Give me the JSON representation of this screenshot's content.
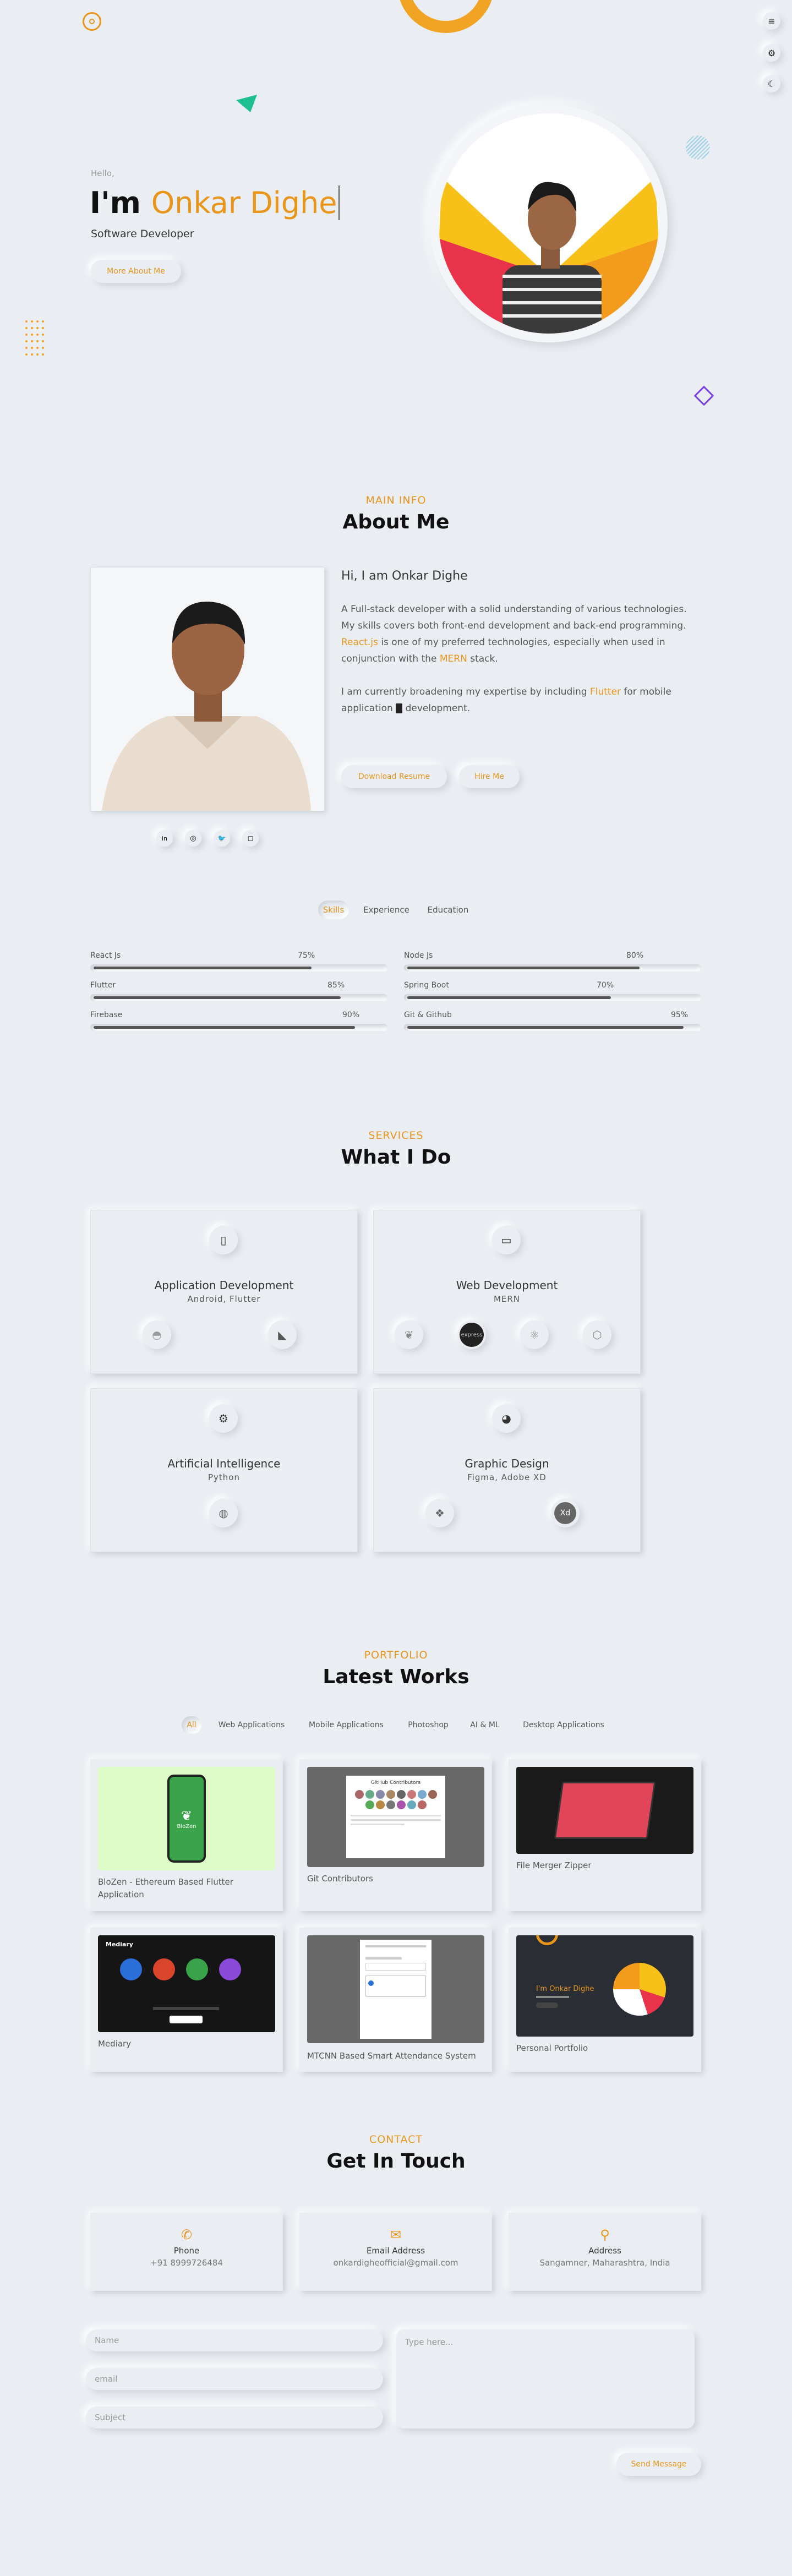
{
  "colors": {
    "accent": "#e8951a",
    "background": "#eaeef3",
    "text": "#111111"
  },
  "hero": {
    "hello": "Hello,",
    "im": "I'm ",
    "name": "Onkar Dighe",
    "role": "Software Developer",
    "more_btn": "More About Me"
  },
  "side_controls": [
    "menu-icon",
    "gear-icon",
    "moon-icon"
  ],
  "about": {
    "subtitle": "MAIN INFO",
    "title": "About Me",
    "greeting": "Hi, I am Onkar Dighe",
    "p1": "A Full-stack developer with a solid understanding of various technologies.",
    "p2": "My skills covers both front-end development and back-end programming.",
    "p3_a": "React.js",
    "p3_b": " is one of my preferred technologies, especially when used in conjunction with the ",
    "p3_c": "MERN",
    "p3_d": " stack.",
    "p4_a": "I am currently broadening my expertise by including ",
    "p4_b": "Flutter",
    "p4_c": " for mobile application ",
    "p4_d": " development.",
    "download_btn": "Download Resume",
    "hire_btn": "Hire Me",
    "socials": [
      "linkedin-icon",
      "github-icon",
      "twitter-icon",
      "instagram-icon"
    ]
  },
  "skill_tabs": [
    "Skills",
    "Experience",
    "Education"
  ],
  "skills": [
    {
      "name": "React Js",
      "value": 75,
      "label": "75%"
    },
    {
      "name": "Node Js",
      "value": 80,
      "label": "80%"
    },
    {
      "name": "Flutter",
      "value": 85,
      "label": "85%"
    },
    {
      "name": "Spring Boot",
      "value": 70,
      "label": "70%"
    },
    {
      "name": "Firebase",
      "value": 90,
      "label": "90%"
    },
    {
      "name": "Git & Github",
      "value": 95,
      "label": "95%"
    }
  ],
  "services": {
    "subtitle": "SERVICES",
    "title": "What I Do",
    "items": [
      {
        "title": "Application Development",
        "sub": "Android, Flutter",
        "icon": "mobile-icon",
        "techs": [
          "android-icon",
          "flutter-icon"
        ]
      },
      {
        "title": "Web Development",
        "sub": "MERN",
        "icon": "laptop-icon",
        "techs": [
          "mongodb-icon",
          "express-icon",
          "react-icon",
          "nodejs-icon"
        ]
      },
      {
        "title": "Artificial Intelligence",
        "sub": "Python",
        "icon": "cog-icon",
        "techs": [
          "python-icon"
        ]
      },
      {
        "title": "Graphic Design",
        "sub": "Figma, Adobe XD",
        "icon": "palette-icon",
        "techs": [
          "figma-icon",
          "xd-icon"
        ]
      }
    ],
    "express_label": "express",
    "xd_label": "Xd"
  },
  "portfolio": {
    "subtitle": "PORTFOLIO",
    "title": "Latest Works",
    "filters": [
      "All",
      "Web Applications",
      "Mobile Applications",
      "Photoshop",
      "AI & ML",
      "Desktop Applications"
    ],
    "works": [
      {
        "title": "BloZen - Ethereum Based Flutter Application",
        "caption": "BloZen"
      },
      {
        "title": "Git Contributors",
        "caption": "GitHub Contributors"
      },
      {
        "title": "File Merger Zipper",
        "caption": ""
      },
      {
        "title": "Mediary",
        "caption": "Mediary"
      },
      {
        "title": "MTCNN Based Smart Attendance System",
        "caption": ""
      },
      {
        "title": "Personal Portfolio",
        "caption": "I'm Onkar Dighe"
      }
    ]
  },
  "contact": {
    "subtitle": "CONTACT",
    "title": "Get In Touch",
    "items": [
      {
        "label": "Phone",
        "value": "+91 8999726484",
        "icon": "phone-icon"
      },
      {
        "label": "Email Address",
        "value": "onkardigheofficial@gmail.com",
        "icon": "envelope-icon"
      },
      {
        "label": "Address",
        "value": "Sangamner, Maharashtra, India",
        "icon": "location-icon"
      }
    ],
    "name_ph": "Name",
    "email_ph": "email",
    "subject_ph": "Subject",
    "message_ph": "Type here...",
    "send_btn": "Send Message"
  }
}
